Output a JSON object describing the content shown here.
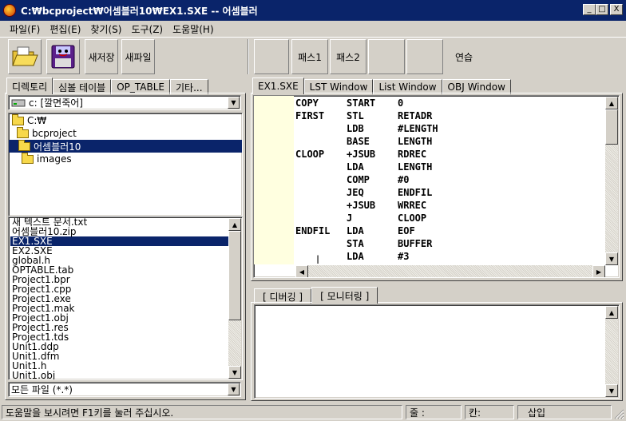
{
  "window": {
    "title": "C:₩bcproject₩어셈블러10₩EX1.SXE  -- 어셈블러",
    "minimize": "_",
    "maximize": "□",
    "close": "X"
  },
  "menu": [
    "파일(F)",
    "편집(E)",
    "찾기(S)",
    "도구(Z)",
    "도움말(H)"
  ],
  "toolbar": {
    "save_as": "새저장",
    "new_file": "새파일",
    "pass1": "패스1",
    "pass2": "패스2",
    "practice": "연습"
  },
  "left_tabs": [
    "디렉토리",
    "심볼 테이블",
    "OP_TABLE",
    "기타..."
  ],
  "drive_combo": "c: [깔면죽어]",
  "tree": [
    {
      "label": "C:₩",
      "indent": 0
    },
    {
      "label": "bcproject",
      "indent": 1
    },
    {
      "label": "어셈블러10",
      "indent": 1,
      "selected": true
    },
    {
      "label": "images",
      "indent": 1
    }
  ],
  "files": [
    "새 텍스트 문서.txt",
    "어셈블러10.zip",
    "EX1.SXE",
    "EX2.SXE",
    "global.h",
    "OPTABLE.tab",
    "Project1.bpr",
    "Project1.cpp",
    "Project1.exe",
    "Project1.mak",
    "Project1.obj",
    "Project1.res",
    "Project1.tds",
    "Unit1.ddp",
    "Unit1.dfm",
    "Unit1.h",
    "Unit1.obj"
  ],
  "selected_file_index": 2,
  "filter_combo": "모든 파일 (*.*)",
  "editor_tabs": [
    "EX1.SXE",
    "LST Window",
    "List Window",
    "OBJ Window"
  ],
  "code": [
    [
      "COPY",
      "START",
      "0"
    ],
    [
      "FIRST",
      "STL",
      "RETADR"
    ],
    [
      "",
      "LDB",
      "#LENGTH"
    ],
    [
      "",
      "BASE",
      "LENGTH"
    ],
    [
      "CLOOP",
      "+JSUB",
      "RDREC"
    ],
    [
      "",
      "LDA",
      "LENGTH"
    ],
    [
      "",
      "COMP",
      "#0"
    ],
    [
      "",
      "JEQ",
      "ENDFIL"
    ],
    [
      "",
      "+JSUB",
      "WRREC"
    ],
    [
      "",
      "J",
      "CLOOP"
    ],
    [
      "ENDFIL",
      "LDA",
      "EOF"
    ],
    [
      "",
      "STA",
      "BUFFER"
    ],
    [
      "",
      "LDA",
      "#3"
    ]
  ],
  "bottom_tabs": [
    "[ 디버깅 ]",
    "[ 모니터링 ]"
  ],
  "status": {
    "help": "도움말을 보시려면 F1키를 눌러 주십시오.",
    "line": "줄 :",
    "col": "칸:",
    "mode": "삽입"
  }
}
